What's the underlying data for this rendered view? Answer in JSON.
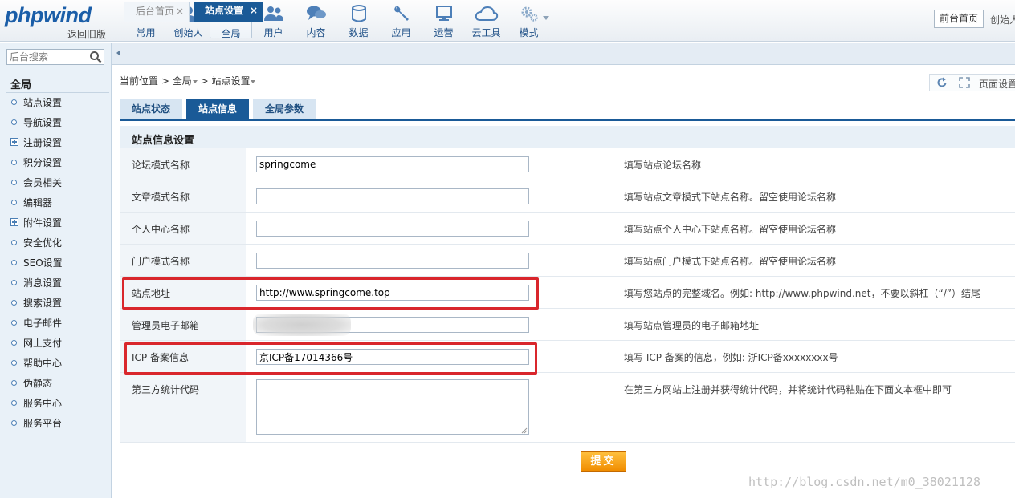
{
  "header": {
    "logo_text": "phpwind",
    "logo_sub": "返回旧版",
    "nav": [
      {
        "label": "常用",
        "icon": "star-icon"
      },
      {
        "label": "创始人",
        "icon": "person-icon"
      },
      {
        "label": "全局",
        "icon": "globe-icon",
        "active": true
      },
      {
        "label": "用户",
        "icon": "users-icon"
      },
      {
        "label": "内容",
        "icon": "chat-bubbles-icon"
      },
      {
        "label": "数据",
        "icon": "database-icon"
      },
      {
        "label": "应用",
        "icon": "wrench-icon"
      },
      {
        "label": "运营",
        "icon": "monitor-icon"
      },
      {
        "label": "云工具",
        "icon": "cloud-icon"
      },
      {
        "label": "模式",
        "icon": "gears-icon"
      }
    ],
    "front_button": "前台首页",
    "founder_text": "创始人"
  },
  "sidebar": {
    "search_placeholder": "后台搜索",
    "title": "全局",
    "items": [
      {
        "label": "站点设置",
        "marker": "bullet"
      },
      {
        "label": "导航设置",
        "marker": "bullet"
      },
      {
        "label": "注册设置",
        "marker": "plus"
      },
      {
        "label": "积分设置",
        "marker": "bullet"
      },
      {
        "label": "会员相关",
        "marker": "bullet"
      },
      {
        "label": "编辑器",
        "marker": "bullet"
      },
      {
        "label": "附件设置",
        "marker": "plus"
      },
      {
        "label": "安全优化",
        "marker": "bullet"
      },
      {
        "label": "SEO设置",
        "marker": "bullet"
      },
      {
        "label": "消息设置",
        "marker": "bullet"
      },
      {
        "label": "搜索设置",
        "marker": "bullet"
      },
      {
        "label": "电子邮件",
        "marker": "bullet"
      },
      {
        "label": "网上支付",
        "marker": "bullet"
      },
      {
        "label": "帮助中心",
        "marker": "bullet"
      },
      {
        "label": "伪静态",
        "marker": "bullet"
      },
      {
        "label": "服务中心",
        "marker": "bullet"
      },
      {
        "label": "服务平台",
        "marker": "bullet"
      }
    ]
  },
  "tabs": {
    "inactive": "后台首页",
    "active": "站点设置",
    "close_glyph": "×"
  },
  "breadcrumb": {
    "prefix": "当前位置",
    "sep": ">",
    "level1": "全局",
    "level2": "站点设置"
  },
  "page_tools": {
    "label": "页面设置"
  },
  "subtabs": [
    "站点状态",
    "站点信息",
    "全局参数"
  ],
  "form": {
    "section_title": "站点信息设置",
    "rows": [
      {
        "label": "论坛模式名称",
        "value": "springcome",
        "help": "填写站点论坛名称"
      },
      {
        "label": "文章模式名称",
        "value": "",
        "help": "填写站点文章模式下站点名称。留空使用论坛名称"
      },
      {
        "label": "个人中心名称",
        "value": "",
        "help": "填写站点个人中心下站点名称。留空使用论坛名称"
      },
      {
        "label": "门户模式名称",
        "value": "",
        "help": "填写站点门户模式下站点名称。留空使用论坛名称"
      },
      {
        "label": "站点地址",
        "value": "http://www.springcome.top",
        "help": "填写您站点的完整域名。例如: http://www.phpwind.net，不要以斜杠（“/”）结尾"
      },
      {
        "label": "管理员电子邮箱",
        "value": "",
        "help": "填写站点管理员的电子邮箱地址"
      },
      {
        "label": "ICP 备案信息",
        "value": "京ICP备17014366号",
        "help": "填写 ICP 备案的信息，例如: 浙ICP备xxxxxxxx号"
      },
      {
        "label": "第三方统计代码",
        "value": "",
        "help": "在第三方网站上注册并获得统计代码，并将统计代码粘贴在下面文本框中即可"
      }
    ],
    "submit": "提交"
  },
  "watermark": "http://blog.csdn.net/m0_38021128",
  "colors": {
    "brand": "#1b5ea8",
    "active_tab": "#1a5a97",
    "highlight": "#d9262c",
    "submit": "#f5a00a"
  }
}
